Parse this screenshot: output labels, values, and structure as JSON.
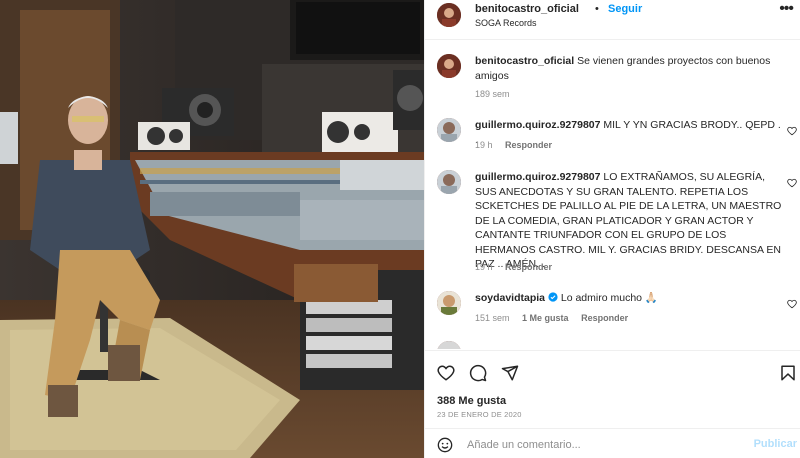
{
  "post": {
    "username": "benitocastro_oficial",
    "dot": "•",
    "follow_label": "Seguir",
    "location": "SOGA Records",
    "more_icon": "more-horizontal-icon"
  },
  "caption": {
    "username": "benitocastro_oficial",
    "text": "Se vienen grandes proyectos con buenos amigos",
    "age": "189 sem"
  },
  "comments": [
    {
      "username": "guillermo.quiroz.9279807",
      "text": "MIL Y YN GRACIAS BRODY.. QEPD . .",
      "age": "19 h",
      "reply_label": "Responder"
    },
    {
      "username": "guillermo.quiroz.9279807",
      "text": "LO EXTRAÑAMOS, SU ALEGRÍA, SUS ANECDOTAS Y SU GRAN TALENTO. REPETIA LOS SCKETCHES DE PALILLO AL PIE DE LA LETRA, UN MAESTRO DE LA COMEDIA, GRAN PLATICADOR Y GRAN ACTOR Y CANTANTE TRIUNFADOR CON EL GRUPO DE LOS HERMANOS CASTRO. MIL Y. GRACIAS BRIDY. DESCANSA EN PAZ .. AMÉN. .",
      "age": "19 h",
      "reply_label": "Responder"
    },
    {
      "username": "soydavidtapia",
      "verified": true,
      "text": "Lo admiro mucho 🙏🏻",
      "age": "151 sem",
      "likes": "1 Me gusta",
      "reply_label": "Responder"
    }
  ],
  "actions": {
    "like_icon": "heart-icon",
    "comment_icon": "comment-icon",
    "share_icon": "send-icon",
    "save_icon": "bookmark-icon"
  },
  "likes_text": "388 Me gusta",
  "date_text": "23 DE ENERO DE 2020",
  "add_comment": {
    "placeholder": "Añade un comentario...",
    "publish_label": "Publicar",
    "emoji_icon": "smiley-icon"
  },
  "colors": {
    "link_blue": "#0095f6",
    "publish_disabled": "#b2dffc",
    "muted": "#8e8e8e"
  }
}
